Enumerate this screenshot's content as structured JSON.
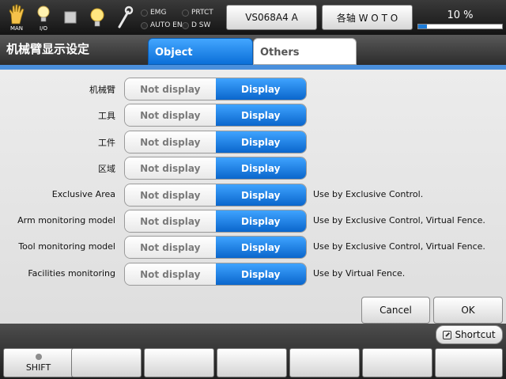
{
  "status": {
    "man_label": "MAN",
    "io_label": "I/O",
    "lamps": [
      "EMG",
      "PRTCT",
      "AUTO EN",
      "D SW"
    ],
    "robot_button": "VS068A4 A",
    "axis_button": "各轴 W O T O",
    "speed_text": "10 %",
    "speed_value": 10
  },
  "header": {
    "title": "机械臂显示设定",
    "tabs": [
      "Object",
      "Others"
    ]
  },
  "rows": [
    {
      "label": "机械臂",
      "off": "Not display",
      "on": "Display",
      "note": ""
    },
    {
      "label": "工具",
      "off": "Not display",
      "on": "Display",
      "note": ""
    },
    {
      "label": "工件",
      "off": "Not display",
      "on": "Display",
      "note": ""
    },
    {
      "label": "区域",
      "off": "Not display",
      "on": "Display",
      "note": ""
    },
    {
      "label": "Exclusive Area",
      "off": "Not display",
      "on": "Display",
      "note": "Use by Exclusive Control."
    },
    {
      "label": "Arm monitoring model",
      "off": "Not display",
      "on": "Display",
      "note": "Use by Exclusive Control, Virtual Fence."
    },
    {
      "label": "Tool monitoring model",
      "off": "Not display",
      "on": "Display",
      "note": "Use by Exclusive Control, Virtual Fence."
    },
    {
      "label": "Facilities monitoring",
      "off": "Not display",
      "on": "Display",
      "note": "Use by Virtual Fence."
    }
  ],
  "dialog": {
    "cancel": "Cancel",
    "ok": "OK"
  },
  "bottom": {
    "shortcut": "Shortcut",
    "shift": "SHIFT"
  },
  "colors": {
    "accent": "#1b7bd8",
    "selected": "#0a66cc"
  }
}
